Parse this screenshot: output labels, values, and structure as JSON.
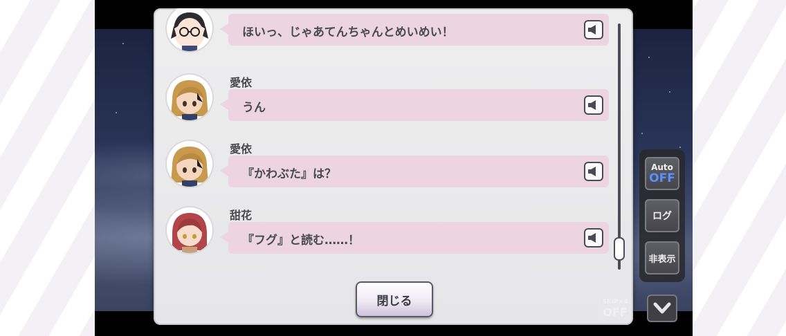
{
  "log": {
    "entries": [
      {
        "speaker": "",
        "text": "ほいっ、じゃあてんちゃんとめいめい！",
        "avatar": "glasses-dark-hair-girl",
        "voice_icon": "speaker-icon"
      },
      {
        "speaker": "愛依",
        "text": "うん",
        "avatar": "blonde-girl",
        "voice_icon": "speaker-icon"
      },
      {
        "speaker": "愛依",
        "text": "『かわぶた』は？",
        "avatar": "blonde-girl",
        "voice_icon": "speaker-icon"
      },
      {
        "speaker": "甜花",
        "text": "『フグ』と読む……！",
        "avatar": "red-hair-girl",
        "voice_icon": "speaker-icon"
      }
    ],
    "close_label": "閉じる"
  },
  "side": {
    "auto_top": "Auto",
    "auto_bottom": "OFF",
    "log_label": "ログ",
    "hide_label": "非表示",
    "skip_top": "SKIP×4",
    "skip_bottom": "OFF"
  },
  "colors": {
    "bubble": "#ecd5e0",
    "panel": "#eeeeef",
    "auto_off": "#5a8fff"
  }
}
